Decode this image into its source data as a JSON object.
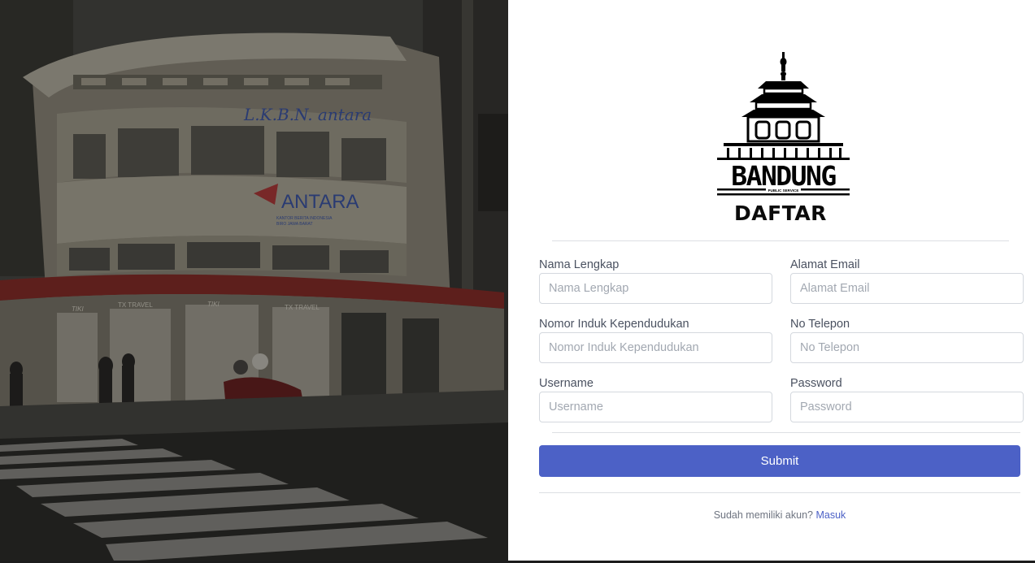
{
  "photo": {
    "signs": {
      "building_name": "L.K.B.N. antara",
      "brand": "ANTARA",
      "brand_sub": "KANTOR BERITA INDONESIA",
      "brand_sub2": "BIRO JAWA BARAT",
      "shop1": "TIKI",
      "shop2": "TX TRAVEL",
      "shop3": "TIKI",
      "shop4": "TX TRAVEL"
    }
  },
  "logo": {
    "name": "BANDUNG",
    "tagline": "PUBLIC SERVICE"
  },
  "form": {
    "title": "DAFTAR",
    "fields": {
      "full_name": {
        "label": "Nama Lengkap",
        "placeholder": "Nama Lengkap",
        "value": ""
      },
      "email": {
        "label": "Alamat Email",
        "placeholder": "Alamat Email",
        "value": ""
      },
      "nik": {
        "label": "Nomor Induk Kependudukan",
        "placeholder": "Nomor Induk Kependudukan",
        "value": ""
      },
      "phone": {
        "label": "No Telepon",
        "placeholder": "No Telepon",
        "value": ""
      },
      "username": {
        "label": "Username",
        "placeholder": "Username",
        "value": ""
      },
      "password": {
        "label": "Password",
        "placeholder": "Password",
        "value": ""
      }
    },
    "submit_label": "Submit",
    "footer_text": "Sudah memiliki akun?",
    "footer_link": "Masuk"
  },
  "colors": {
    "primary": "#4c61c6",
    "photo_overlay": "#000000",
    "title": "#0b0b0b"
  }
}
